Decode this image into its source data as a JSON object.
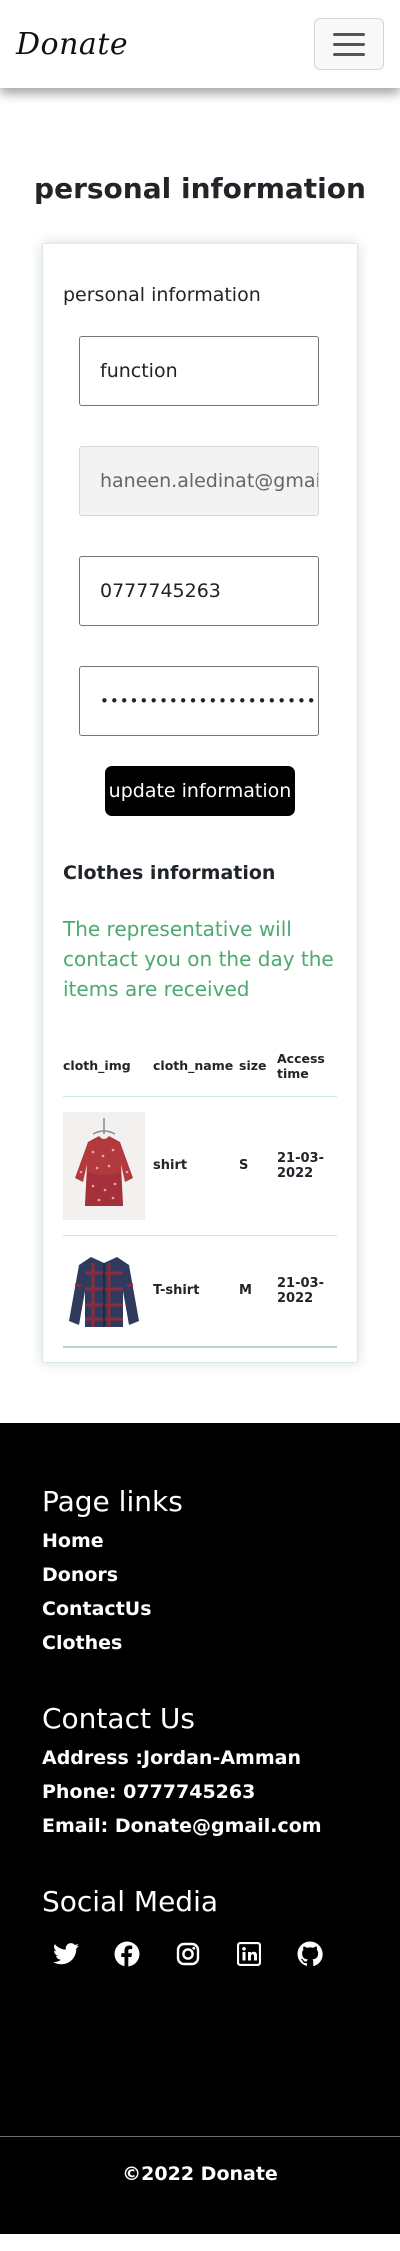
{
  "header": {
    "brand": "Donate",
    "menu_icon": "hamburger-icon"
  },
  "page": {
    "title": "personal information"
  },
  "personal": {
    "title": "personal information",
    "name_value": "function",
    "email_value": "haneen.aledinat@gmail.com",
    "phone_value": "0777745263",
    "password_value": "••••••••••••••••••••••••••",
    "update_label": "update information"
  },
  "clothes": {
    "title": "Clothes information",
    "notice": "The representative will contact you on the day the items are received",
    "columns": [
      "cloth_img",
      "cloth_name",
      "size",
      "Access time"
    ],
    "rows": [
      {
        "name": "shirt",
        "size": "S",
        "time": "21-03-2022"
      },
      {
        "name": "T-shirt",
        "size": "M",
        "time": "21-03-2022"
      }
    ]
  },
  "footer": {
    "links_title": "Page links",
    "links": [
      "Home",
      "Donors",
      "ContactUs",
      "Clothes"
    ],
    "contact_title": "Contact Us",
    "address": "Address :Jordan-Amman",
    "phone": "Phone: 0777745263",
    "email": "Email: Donate@gmail.com",
    "social_title": "Social Media",
    "social_icons": [
      "twitter-icon",
      "facebook-icon",
      "instagram-icon",
      "linkedin-icon",
      "github-icon"
    ],
    "copyright": "©2022 Donate"
  },
  "colors": {
    "accent_green": "#4caa6e",
    "footer_bg": "#000000",
    "button_bg": "#000000"
  }
}
